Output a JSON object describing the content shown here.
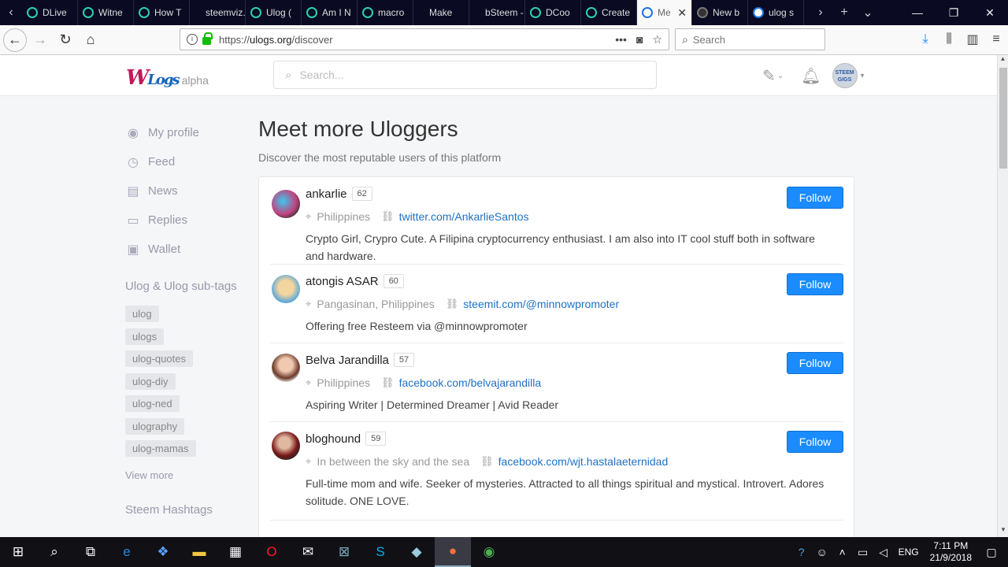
{
  "browser": {
    "tabs": [
      {
        "label": "DLive",
        "icon": "dlive-icon"
      },
      {
        "label": "Witne",
        "icon": "steem-icon"
      },
      {
        "label": "How T",
        "icon": "steem-icon"
      },
      {
        "label": "steemviz.c",
        "icon": "none"
      },
      {
        "label": "Ulog (",
        "icon": "steem-icon"
      },
      {
        "label": "Am I N",
        "icon": "steem-icon"
      },
      {
        "label": "macro",
        "icon": "steem-icon"
      },
      {
        "label": "Make",
        "icon": "none"
      },
      {
        "label": "bSteem - I",
        "icon": "none"
      },
      {
        "label": "DCoo",
        "icon": "steem-icon"
      },
      {
        "label": "Create",
        "icon": "steem-icon"
      },
      {
        "label": "Me",
        "icon": "ulog-icon",
        "active": true
      },
      {
        "label": "New b",
        "icon": "github-icon"
      },
      {
        "label": "ulog s",
        "icon": "google-icon"
      }
    ],
    "url_scheme": "https://",
    "url_host": "ulogs.org",
    "url_path": "/discover",
    "search_placeholder": "Search"
  },
  "site": {
    "logo_alpha": "alpha",
    "search_placeholder": "Search...",
    "avatar_text": "STEEM GIGS"
  },
  "sidebar": {
    "items": [
      {
        "label": "My profile",
        "icon": "user-circle-icon"
      },
      {
        "label": "Feed",
        "icon": "clock-icon"
      },
      {
        "label": "News",
        "icon": "news-icon"
      },
      {
        "label": "Replies",
        "icon": "comment-icon"
      },
      {
        "label": "Wallet",
        "icon": "wallet-icon"
      }
    ],
    "section_title": "Ulog & Ulog sub-tags",
    "tags": [
      "ulog",
      "ulogs",
      "ulog-quotes",
      "ulog-diy",
      "ulog-ned",
      "ulography",
      "ulog-mamas"
    ],
    "view_more": "View more",
    "section2_title": "Steem Hashtags"
  },
  "main": {
    "title": "Meet more Uloggers",
    "subtitle": "Discover the most reputable users of this platform",
    "follow_label": "Follow",
    "users": [
      {
        "name": "ankarlie",
        "rep": "62",
        "location": "Philippines",
        "link": "twitter.com/AnkarlieSantos",
        "bio": "Crypto Girl, Crypro Cute. A Filipina cryptocurrency enthusiast. I am also into IT cool stuff both in software and hardware."
      },
      {
        "name": "atongis ASAR",
        "rep": "60",
        "location": "Pangasinan, Philippines",
        "link": "steemit.com/@minnowpromoter",
        "bio": "Offering free Resteem via @minnowpromoter"
      },
      {
        "name": "Belva Jarandilla",
        "rep": "57",
        "location": "Philippines",
        "link": "facebook.com/belvajarandilla",
        "bio": "Aspiring Writer | Determined Dreamer | Avid Reader"
      },
      {
        "name": "bloghound",
        "rep": "59",
        "location": "In between the sky and the sea",
        "link": "facebook.com/wjt.hastalaeternidad",
        "bio": "Full-time mom and wife. Seeker of mysteries. Attracted to all things spiritual and mystical. Introvert. Adores solitude. ONE LOVE."
      }
    ]
  },
  "taskbar": {
    "lang": "ENG",
    "time": "7:11 PM",
    "date": "21/9/2018"
  },
  "colors": {
    "accent": "#1a8cff",
    "link": "#1f71c4",
    "tabstrip": "#0a0a23"
  }
}
